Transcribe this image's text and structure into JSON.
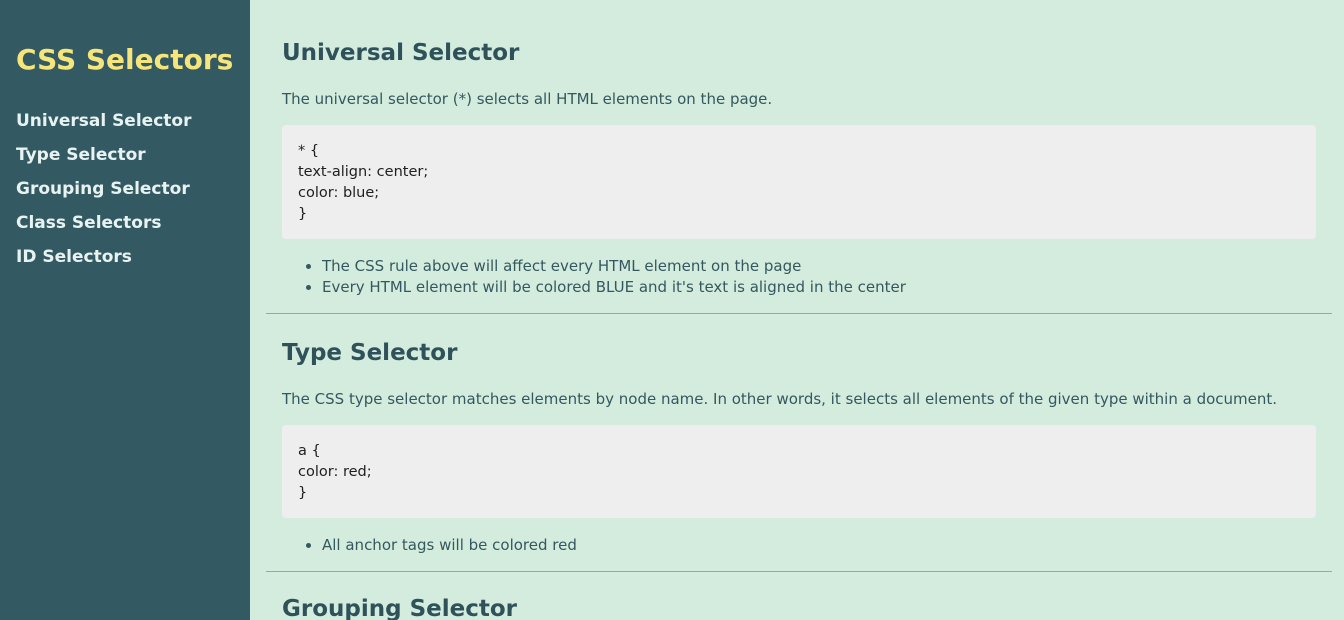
{
  "sidebar": {
    "title": "CSS Selectors",
    "items": [
      {
        "label": "Universal Selector"
      },
      {
        "label": "Type Selector"
      },
      {
        "label": "Grouping Selector"
      },
      {
        "label": "Class Selectors"
      },
      {
        "label": "ID Selectors"
      }
    ]
  },
  "sections": [
    {
      "heading": "Universal Selector",
      "description": "The universal selector (*) selects all HTML elements on the page.",
      "code": "* {\ntext-align: center;\ncolor: blue;\n}",
      "bullets": [
        "The CSS rule above will affect every HTML element on the page",
        "Every HTML element will be colored BLUE and it's text is aligned in the center"
      ]
    },
    {
      "heading": "Type Selector",
      "description": "The CSS type selector matches elements by node name. In other words, it selects all elements of the given type within a document.",
      "code": "a {\ncolor: red;\n}",
      "bullets": [
        "All anchor tags will be colored red"
      ]
    },
    {
      "heading": "Grouping Selector"
    }
  ],
  "colors": {
    "sidebar_bg": "#335a63",
    "brand": "#f6e57a",
    "main_bg": "#d3ecde",
    "code_bg": "#eeeeee",
    "heading": "#2f5159"
  }
}
